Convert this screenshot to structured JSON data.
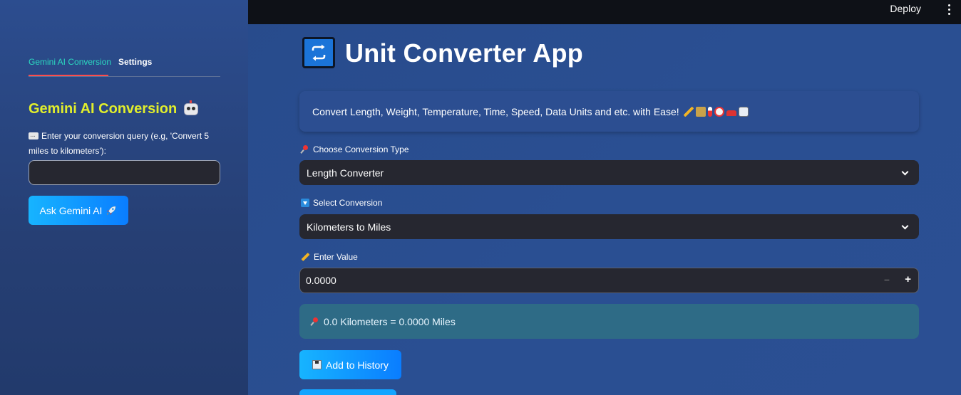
{
  "topbar": {
    "deploy_label": "Deploy"
  },
  "sidebar": {
    "tabs": [
      {
        "label": "Gemini AI Conversion",
        "active": true
      },
      {
        "label": "Settings",
        "active": false
      }
    ],
    "title": "Gemini AI Conversion",
    "title_icon": "robot-icon",
    "query_label": "Enter your conversion query (e.g, 'Convert 5 miles to kilometers'):",
    "query_value": "",
    "ask_button_label": "Ask Gemini AI",
    "ask_button_icon": "rocket-icon"
  },
  "main": {
    "title": "Unit Converter App",
    "title_icon": "repeat-icon",
    "intro_text": "Convert Length, Weight, Temperature, Time, Speed, Data Units and etc. with Ease!",
    "intro_icons": [
      "ruler-icon",
      "scales-icon",
      "thermometer-icon",
      "alarm-clock-icon",
      "car-icon",
      "floppy-disk-icon"
    ],
    "conversion_type": {
      "label": "Choose Conversion Type",
      "selected": "Length Converter"
    },
    "select_conversion": {
      "label": "Select Conversion",
      "selected": "Kilometers to Miles"
    },
    "enter_value": {
      "label": "Enter Value",
      "value": "0.0000"
    },
    "result_text": "0.0 Kilometers = 0.0000 Miles",
    "history_button_label": "Add to History"
  },
  "colors": {
    "accent_title": "#e1ee2c",
    "tab_active": "#2bd9c0",
    "tab_underline": "#ff4b4b",
    "button_gradient_start": "#17b4ff",
    "button_gradient_end": "#0a7dff",
    "result_bg": "#2e6b86"
  }
}
